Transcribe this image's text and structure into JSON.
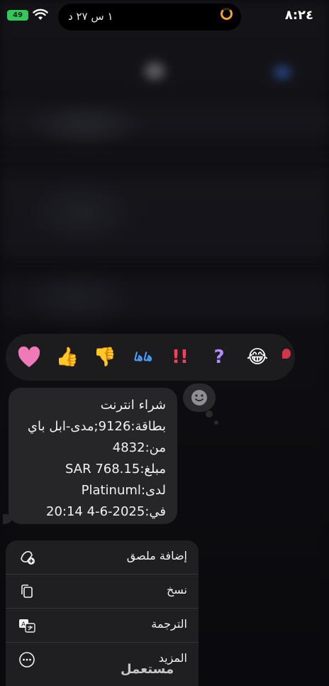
{
  "status_bar": {
    "time": "٨:٢٤",
    "island_text": "١ س ٢٧ د",
    "battery": "49"
  },
  "reactions": [
    {
      "name": "heart",
      "glyph": "❤"
    },
    {
      "name": "thumbs-up",
      "glyph": "👍"
    },
    {
      "name": "thumbs-down",
      "glyph": "👎"
    },
    {
      "name": "haha",
      "glyph": "هاها"
    },
    {
      "name": "exclamation",
      "glyph": "!!"
    },
    {
      "name": "question",
      "glyph": "?"
    },
    {
      "name": "laughing",
      "glyph": "😂"
    }
  ],
  "message": {
    "lines": [
      "شراء انترنت",
      "بطاقة:9126;مدى-ابل باي",
      "من:4832",
      "مبلغ:SAR 768.15",
      "لدى:Platinuml",
      "في:2025-6-4 20:14"
    ]
  },
  "menu": {
    "items": [
      {
        "label": "إضافة ملصق",
        "icon": "sticker-add-icon"
      },
      {
        "label": "نسخ",
        "icon": "copy-icon"
      },
      {
        "label": "الترجمة",
        "icon": "translate-icon"
      },
      {
        "label": "المزيد",
        "icon": "more-icon"
      }
    ]
  },
  "watermark": "مستعمل"
}
